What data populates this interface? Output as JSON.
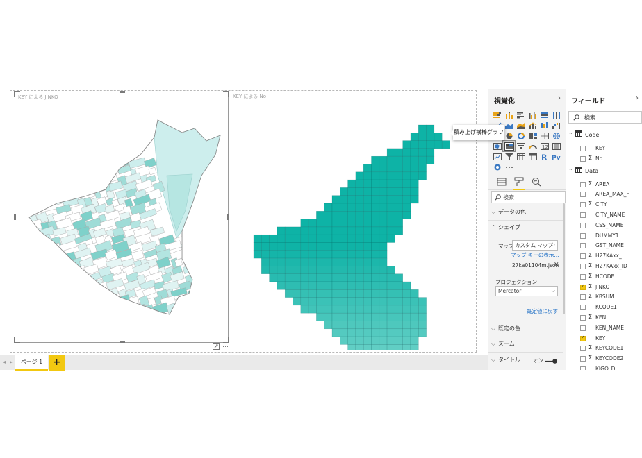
{
  "canvas": {
    "left_visual_title": "KEY による JINKO",
    "right_visual_title": "KEY による No",
    "more_icon": "…"
  },
  "pages": {
    "tab_label": "ページ 1",
    "add_label": "+"
  },
  "visualizations": {
    "title": "視覚化",
    "collapse_glyph": "›",
    "more": "···",
    "tooltip": "積み上げ横棒グラフ",
    "search_placeholder": "検索",
    "sections": {
      "data_colors": "データの色",
      "shape": "シェイプ",
      "default_colors": "既定の色",
      "zoom": "ズーム",
      "title": "タイトル"
    },
    "map_label": "マップ",
    "map_value": "カスタム マップ",
    "map_keys_link": "マップ キーの表示...",
    "map_file": "27ka01104m.json",
    "projection_label": "プロジェクション",
    "projection_value": "Mercator",
    "reset_link": "既定値に戻す",
    "title_toggle_label": "オン",
    "accent_color": "#f2c811"
  },
  "fields": {
    "title": "フィールド",
    "collapse_glyph": "›",
    "search_placeholder": "検索",
    "tables": [
      {
        "name": "Code",
        "items": [
          {
            "name": "KEY",
            "sigma": false,
            "checked": false
          },
          {
            "name": "No",
            "sigma": true,
            "checked": false
          }
        ]
      },
      {
        "name": "Data",
        "items": [
          {
            "name": "AREA",
            "sigma": true,
            "checked": false
          },
          {
            "name": "AREA_MAX_F",
            "sigma": false,
            "checked": false
          },
          {
            "name": "CITY",
            "sigma": true,
            "checked": false
          },
          {
            "name": "CITY_NAME",
            "sigma": false,
            "checked": false
          },
          {
            "name": "CSS_NAME",
            "sigma": false,
            "checked": false
          },
          {
            "name": "DUMMY1",
            "sigma": false,
            "checked": false
          },
          {
            "name": "GST_NAME",
            "sigma": false,
            "checked": false
          },
          {
            "name": "H27KAxx_",
            "sigma": true,
            "checked": false
          },
          {
            "name": "H27KAxx_ID",
            "sigma": true,
            "checked": false
          },
          {
            "name": "HCODE",
            "sigma": true,
            "checked": false
          },
          {
            "name": "JINKO",
            "sigma": true,
            "checked": true
          },
          {
            "name": "KBSUM",
            "sigma": true,
            "checked": false
          },
          {
            "name": "KCODE1",
            "sigma": false,
            "checked": false
          },
          {
            "name": "KEN",
            "sigma": true,
            "checked": false
          },
          {
            "name": "KEN_NAME",
            "sigma": false,
            "checked": false
          },
          {
            "name": "KEY",
            "sigma": false,
            "checked": true
          },
          {
            "name": "KEYCODE1",
            "sigma": true,
            "checked": false
          },
          {
            "name": "KEYCODE2",
            "sigma": true,
            "checked": false
          },
          {
            "name": "KIGO_D",
            "sigma": false,
            "checked": false
          }
        ]
      }
    ]
  },
  "colors": {
    "teal_dark": "#11b5a8",
    "teal_light": "#7fd8d0",
    "choropleth_pale": "#cdeeed",
    "choropleth_mid": "#8fd5d0"
  }
}
